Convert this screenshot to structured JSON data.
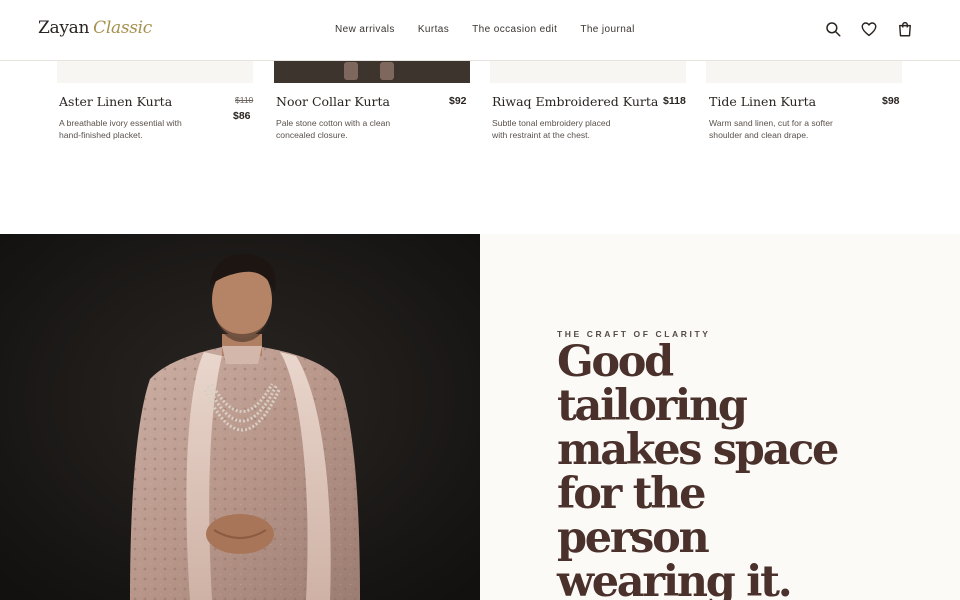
{
  "brand": {
    "name": "Zayan",
    "accent": "Classic"
  },
  "nav": {
    "items": [
      "New arrivals",
      "Kurtas",
      "The occasion edit",
      "The journal"
    ]
  },
  "header_icons": [
    "search-icon",
    "heart-icon",
    "bag-icon"
  ],
  "products": [
    {
      "name": "Aster Linen Kurta",
      "desc": "A breathable ivory essential with hand-finished placket.",
      "price_old": "$110",
      "price": "$86"
    },
    {
      "name": "Noor Collar Kurta",
      "desc": "Pale stone cotton with a clean concealed closure.",
      "price": "$92"
    },
    {
      "name": "Riwaq Embroidered Kurta",
      "desc": "Subtle tonal embroidery placed with restraint at the chest.",
      "price": "$118"
    },
    {
      "name": "Tide Linen Kurta",
      "desc": "Warm sand linen, cut for a softer shoulder and clean drape.",
      "price": "$98"
    }
  ],
  "hero": {
    "eyebrow": "THE CRAFT OF CLARITY",
    "headline": "Good tailoring makes space for the person wearing it."
  },
  "colors": {
    "accent": "#a8914f",
    "headline": "#4a312b",
    "hero_dark": "#171513",
    "hero_light": "#fcfaf7"
  }
}
